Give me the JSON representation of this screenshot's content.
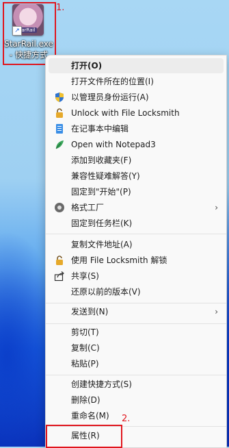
{
  "desktop_icon": {
    "name": "StarRail.exe - 快捷方式",
    "badge": "starRail"
  },
  "annotations": {
    "step1": "1.",
    "step2": "2."
  },
  "menu": {
    "items": [
      {
        "label": "打开(O)",
        "icon": "none"
      },
      {
        "label": "打开文件所在的位置(I)",
        "icon": "none"
      },
      {
        "label": "以管理员身份运行(A)",
        "icon": "uac-shield-icon"
      },
      {
        "label": "Unlock with File Locksmith",
        "icon": "lock-icon"
      },
      {
        "label": "在记事本中编辑",
        "icon": "notepad-icon"
      },
      {
        "label": "Open with Notepad3",
        "icon": "notepad3-icon"
      },
      {
        "label": "添加到收藏夹(F)",
        "icon": "none"
      },
      {
        "label": "兼容性疑难解答(Y)",
        "icon": "none"
      },
      {
        "label": "固定到\"开始\"(P)",
        "icon": "none"
      },
      {
        "label": "格式工厂",
        "icon": "format-factory-icon",
        "submenu": true
      },
      {
        "label": "固定到任务栏(K)",
        "icon": "none"
      },
      {
        "label": "复制文件地址(A)",
        "icon": "none"
      },
      {
        "label": "使用 File Locksmith 解锁",
        "icon": "lock-icon"
      },
      {
        "label": "共享(S)",
        "icon": "share-icon"
      },
      {
        "label": "还原以前的版本(V)",
        "icon": "none"
      },
      {
        "label": "发送到(N)",
        "icon": "none",
        "submenu": true
      },
      {
        "label": "剪切(T)",
        "icon": "none"
      },
      {
        "label": "复制(C)",
        "icon": "none"
      },
      {
        "label": "粘贴(P)",
        "icon": "none"
      },
      {
        "label": "创建快捷方式(S)",
        "icon": "none"
      },
      {
        "label": "删除(D)",
        "icon": "none"
      },
      {
        "label": "重命名(M)",
        "icon": "none"
      },
      {
        "label": "属性(R)",
        "icon": "none"
      }
    ],
    "chevron": "›"
  },
  "colors": {
    "annotation_red": "#e0141c",
    "menu_bg": "#f9f9f9"
  }
}
